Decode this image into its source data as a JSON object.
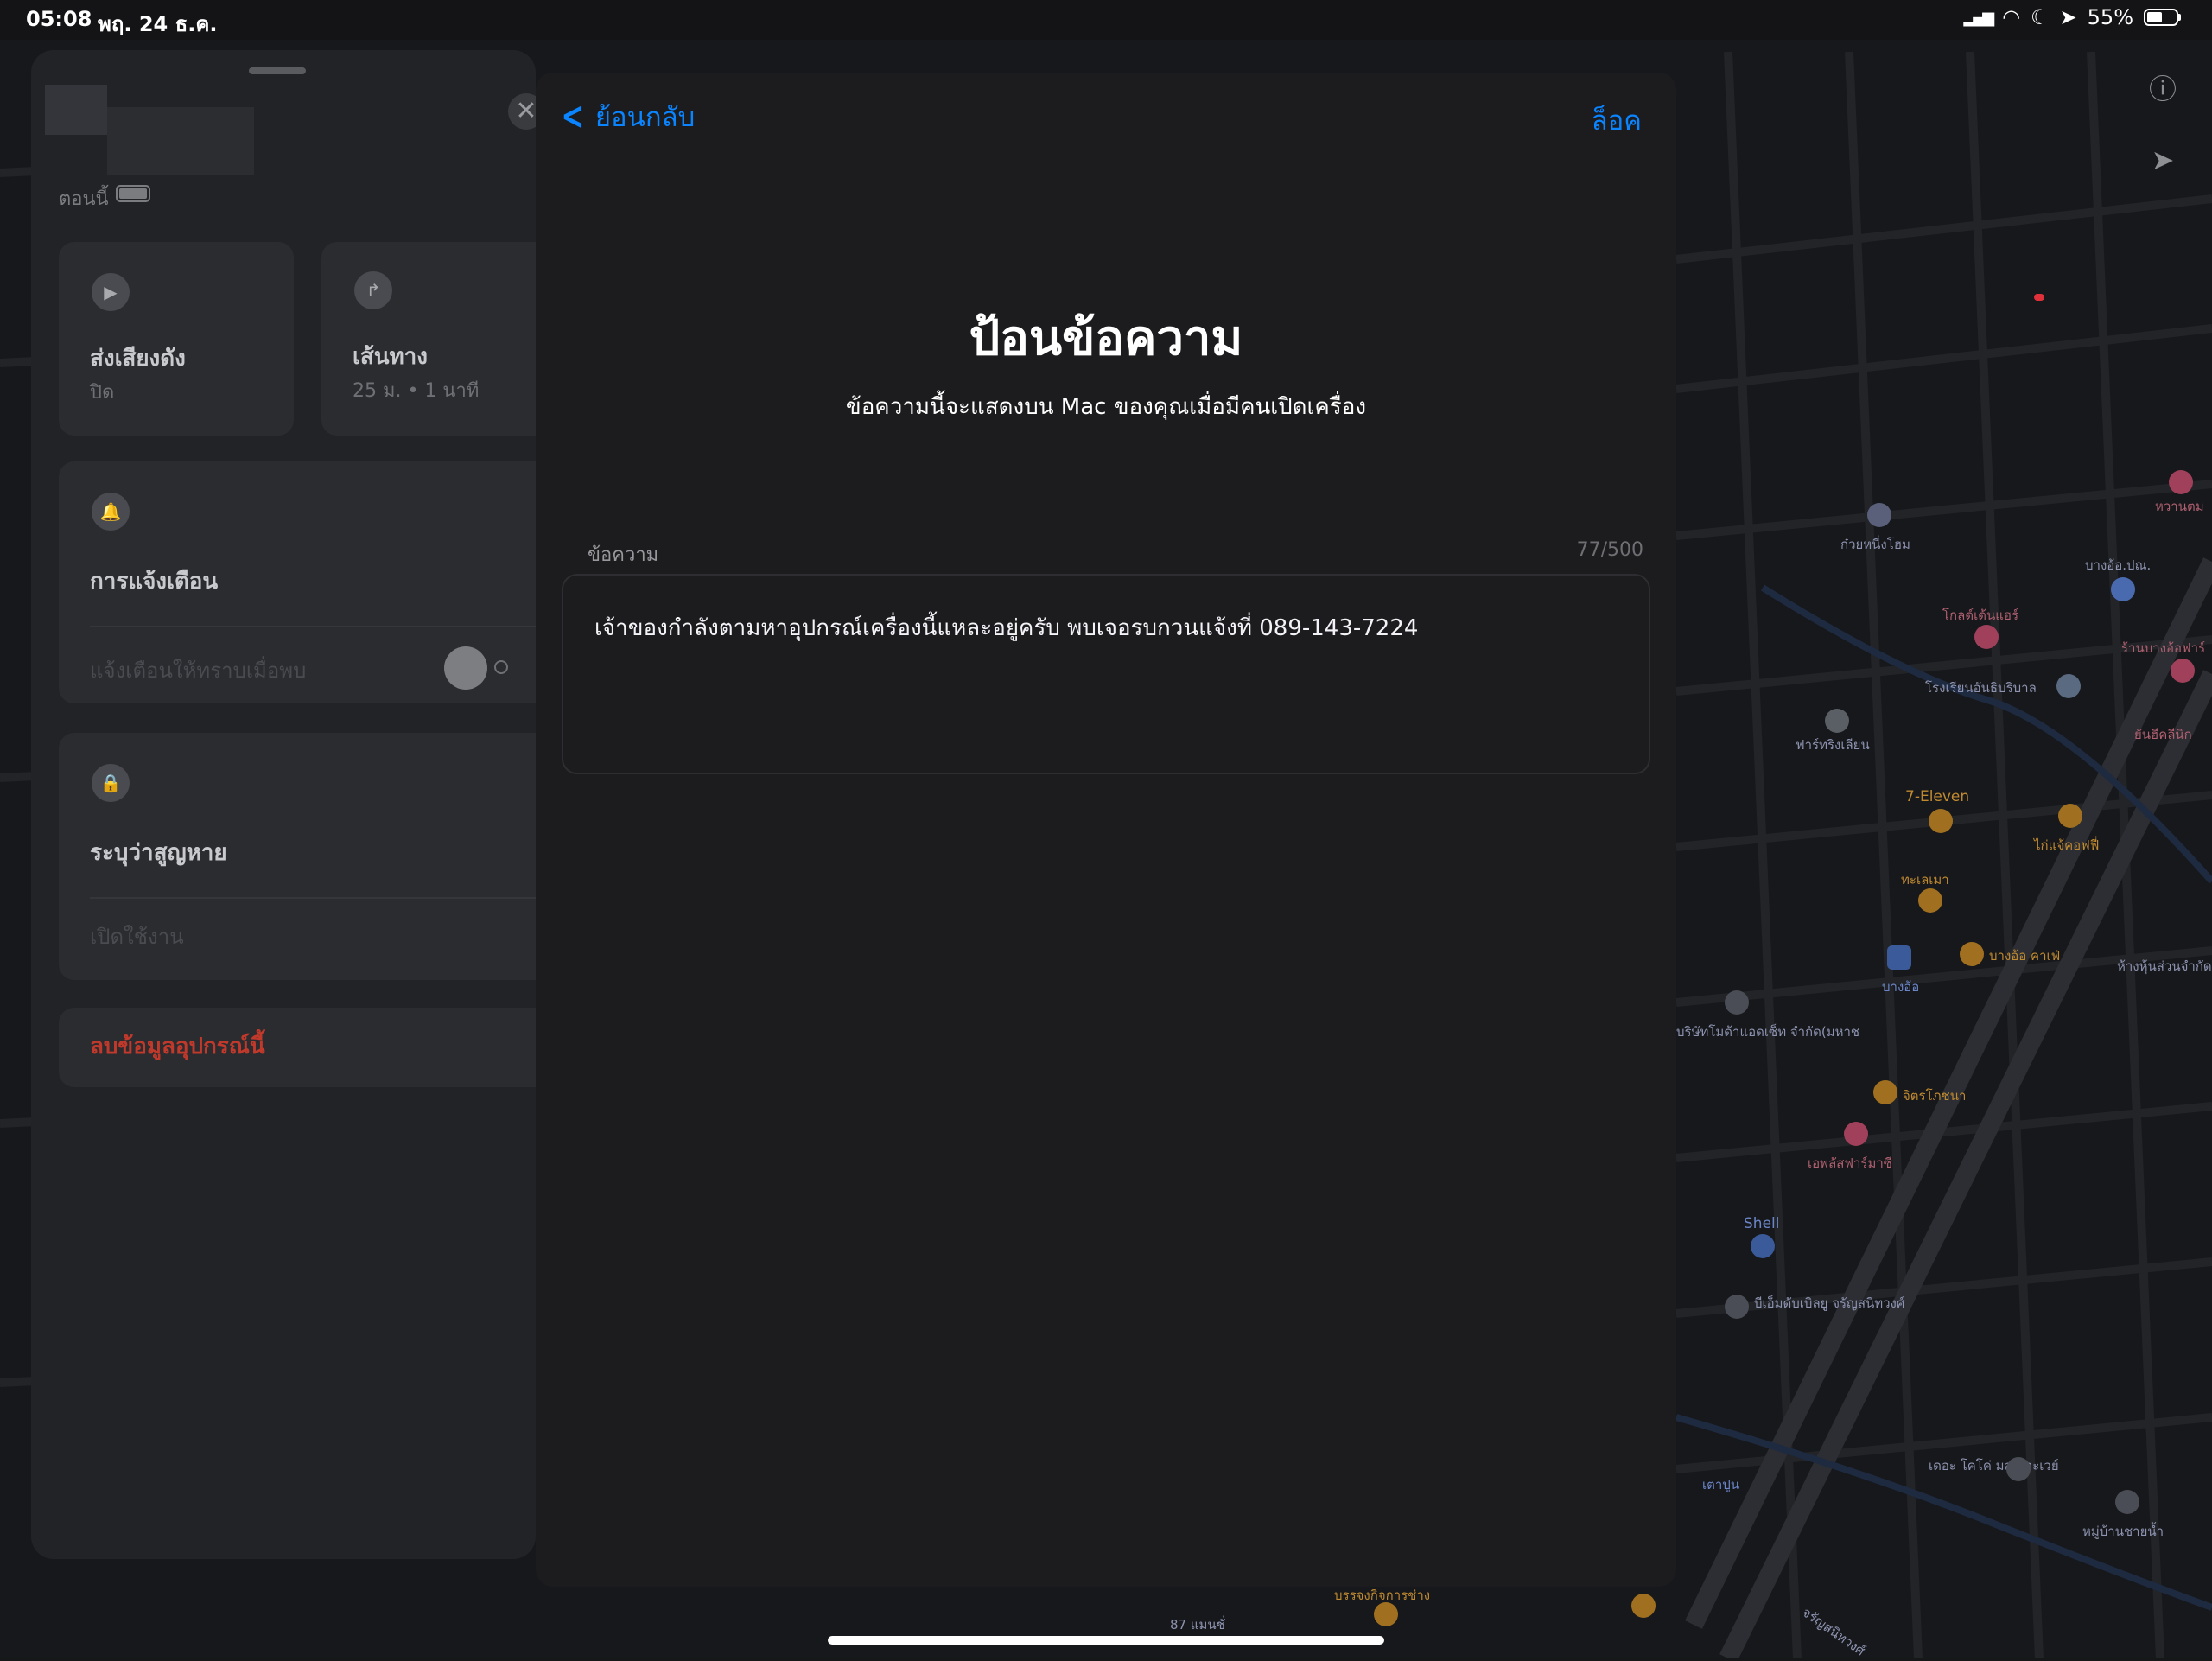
{
  "status_bar": {
    "time": "05:08",
    "date": "พฤ. 24 ธ.ค.",
    "battery": "55%",
    "battery_level": 0.55
  },
  "side_panel": {
    "updated": "ตอนนี้",
    "play_sound": {
      "title": "ส่งเสียงดัง",
      "subtitle": "ปิด"
    },
    "directions": {
      "title": "เส้นทาง",
      "subtitle": "25 ม. • 1 นาที"
    },
    "notifications": {
      "title": "การแจ้งเตือน",
      "option": "แจ้งเตือนให้ทราบเมื่อพบ"
    },
    "mark_lost": {
      "title": "ระบุว่าสูญหาย",
      "action": "เปิดใช้งาน"
    },
    "erase": "ลบข้อมูลอุปกรณ์นี้"
  },
  "sheet": {
    "back_label": "ย้อนกลับ",
    "lock_label": "ล็อค",
    "title": "ป้อนข้อความ",
    "subtitle": "ข้อความนี้จะแสดงบน Mac ของคุณเมื่อมีคนเปิดเครื่อง",
    "field_label": "ข้อความ",
    "counter": "77/500",
    "message": "เจ้าของกำลังตามหาอุปกรณ์เครื่องนี้แหละอยู่ครับ พบเจอรบกวนแจ้งที่ 089-143-7224"
  },
  "map": {
    "labels": {
      "p1": "ก๋วยหนี่งโฮม",
      "p2": "บางอ้อ.ปณ.",
      "p3": "โกลด์เด้นแฮร์",
      "p4": "ร้านบางอ้อฟาร์",
      "p5": "โรงเรียนอันธิบริบาล",
      "p6": "ฟาร์ทริงเลียน",
      "p7": "7-Eleven",
      "p8": "ทะเลเมา",
      "p9": "ไก่แจ้คอฟฟี่",
      "p10": "บางอ้อ",
      "p11": "บางอ้อ คาเฟ่",
      "p12": "ห้างหุ้นส่วนจำกัด",
      "p13": "บริษัทโมด้าแอดเซ็ท จำกัด(มหาช",
      "p14": "จิตรโภชนา",
      "p15": "เอพลัสฟาร์มาซี",
      "p16": "Shell",
      "p17": "บีเอ็มดับเบิลยู จรัญสนิทวงศ์",
      "p18": "เดอะ โคโค่ มลต อะเวย์",
      "p19": "หมู่บ้านชายน้ำ",
      "p20": "87 แมนชั่",
      "p21": "บรรจงกิจการช่าง",
      "p22": "เตาปูน",
      "p23": "จรัญสนิทวงศ์",
      "p24": "หวานตม",
      "p25": "ยันฮีคลีนิก"
    }
  },
  "colors": {
    "accent": "#0a84ff",
    "destructive": "#c0392b",
    "sheet_bg": "#1c1c1e"
  }
}
